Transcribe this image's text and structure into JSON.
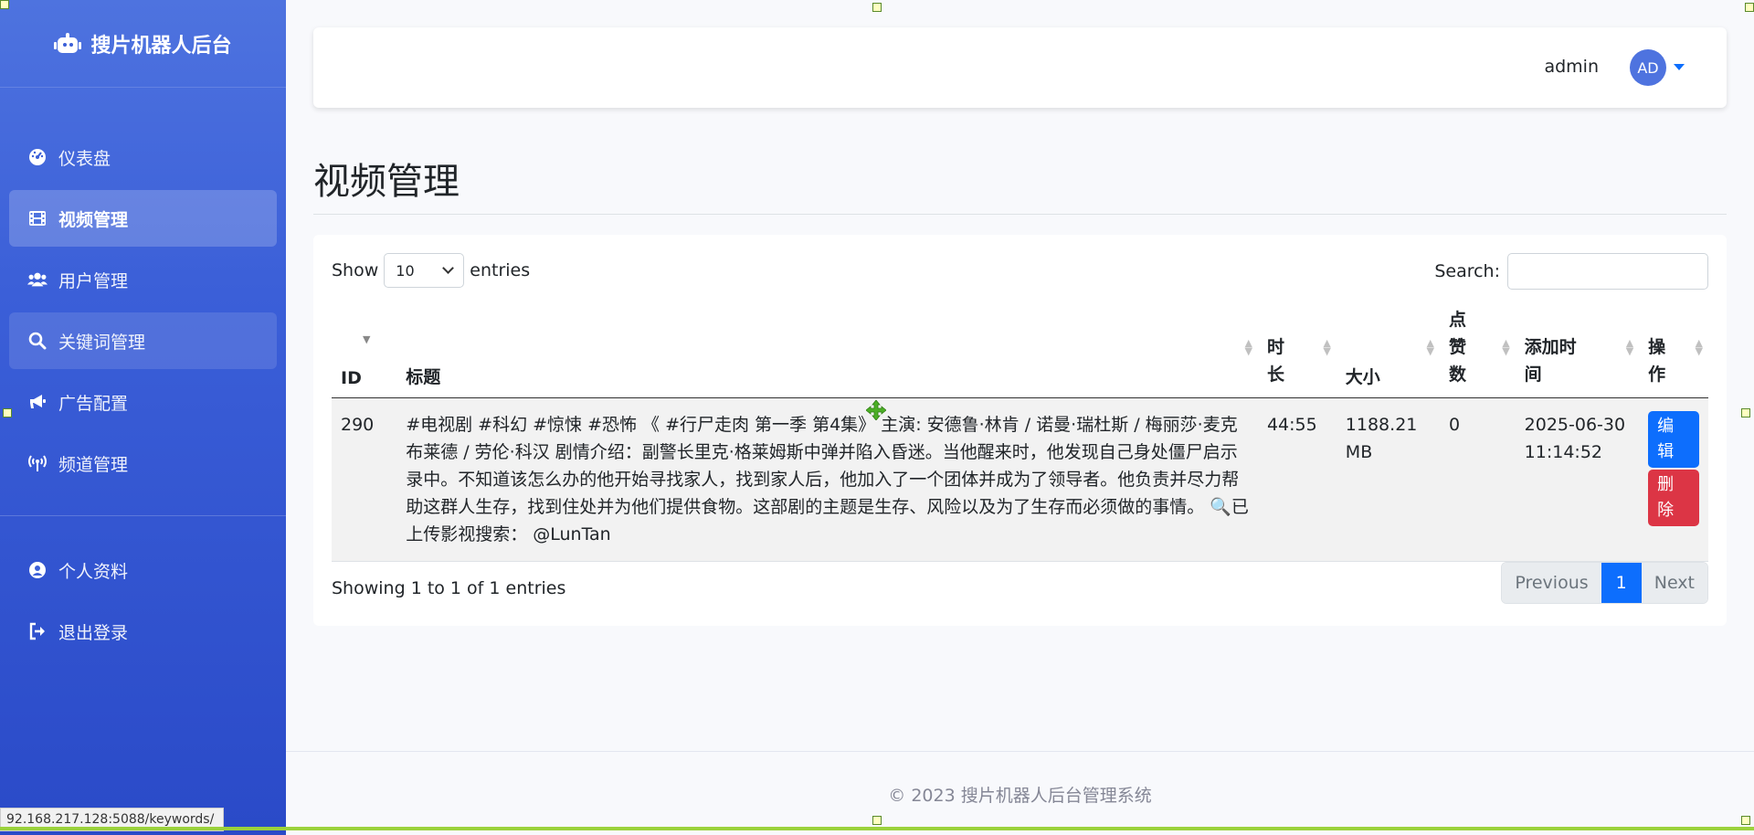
{
  "brand": {
    "title": "搜片机器人后台"
  },
  "sidebar": {
    "items": [
      {
        "label": "仪表盘",
        "icon": "dashboard-icon"
      },
      {
        "label": "视频管理",
        "icon": "film-icon",
        "active": true
      },
      {
        "label": "用户管理",
        "icon": "users-icon"
      },
      {
        "label": "关键词管理",
        "icon": "search-icon",
        "hover": true
      },
      {
        "label": "广告配置",
        "icon": "megaphone-icon"
      },
      {
        "label": "频道管理",
        "icon": "broadcast-icon"
      }
    ],
    "bottom_items": [
      {
        "label": "个人资料",
        "icon": "user-circle-icon"
      },
      {
        "label": "退出登录",
        "icon": "sign-out-icon"
      }
    ]
  },
  "topbar": {
    "username": "admin",
    "avatar_initials": "AD"
  },
  "page": {
    "title": "视频管理"
  },
  "table_controls": {
    "show_label": "Show",
    "entries_label": "entries",
    "page_length": "10",
    "search_label": "Search:",
    "search_value": ""
  },
  "table": {
    "columns": [
      "ID",
      "标题",
      "时长",
      "大小",
      "点赞数",
      "添加时间",
      "操作"
    ],
    "rows": [
      {
        "id": "290",
        "title": "#电视剧 #科幻 #惊悚 #恐怖 《 #行尸走肉 第一季 第4集》 主演: 安德鲁·林肯 / 诺曼·瑞杜斯 / 梅丽莎·麦克布莱德 / 劳伦·科汉 剧情介绍：副警长里克·格莱姆斯中弹并陷入昏迷。当他醒来时，他发现自己身处僵尸启示录中。不知道该怎么办的他开始寻找家人，找到家人后，他加入了一个团体并成为了领导者。他负责并尽力帮助这群人生存，找到住处并为他们提供食物。这部剧的主题是生存、风险以及为了生存而必须做的事情。 🔍已上传影视搜索： @LunTan",
        "duration": "44:55",
        "size": "1188.21 MB",
        "likes": "0",
        "added": "2025-06-30 11:14:52",
        "edit_label": "编辑",
        "delete_label": "删除"
      }
    ]
  },
  "table_info": "Showing 1 to 1 of 1 entries",
  "pagination": {
    "previous": "Previous",
    "current": "1",
    "next": "Next"
  },
  "footer": "© 2023 搜片机器人后台管理系统",
  "status_url": "92.168.217.128:5088/keywords/",
  "colors": {
    "sidebar": "#4e73df",
    "primary": "#0d6efd",
    "danger": "#dc3545"
  }
}
